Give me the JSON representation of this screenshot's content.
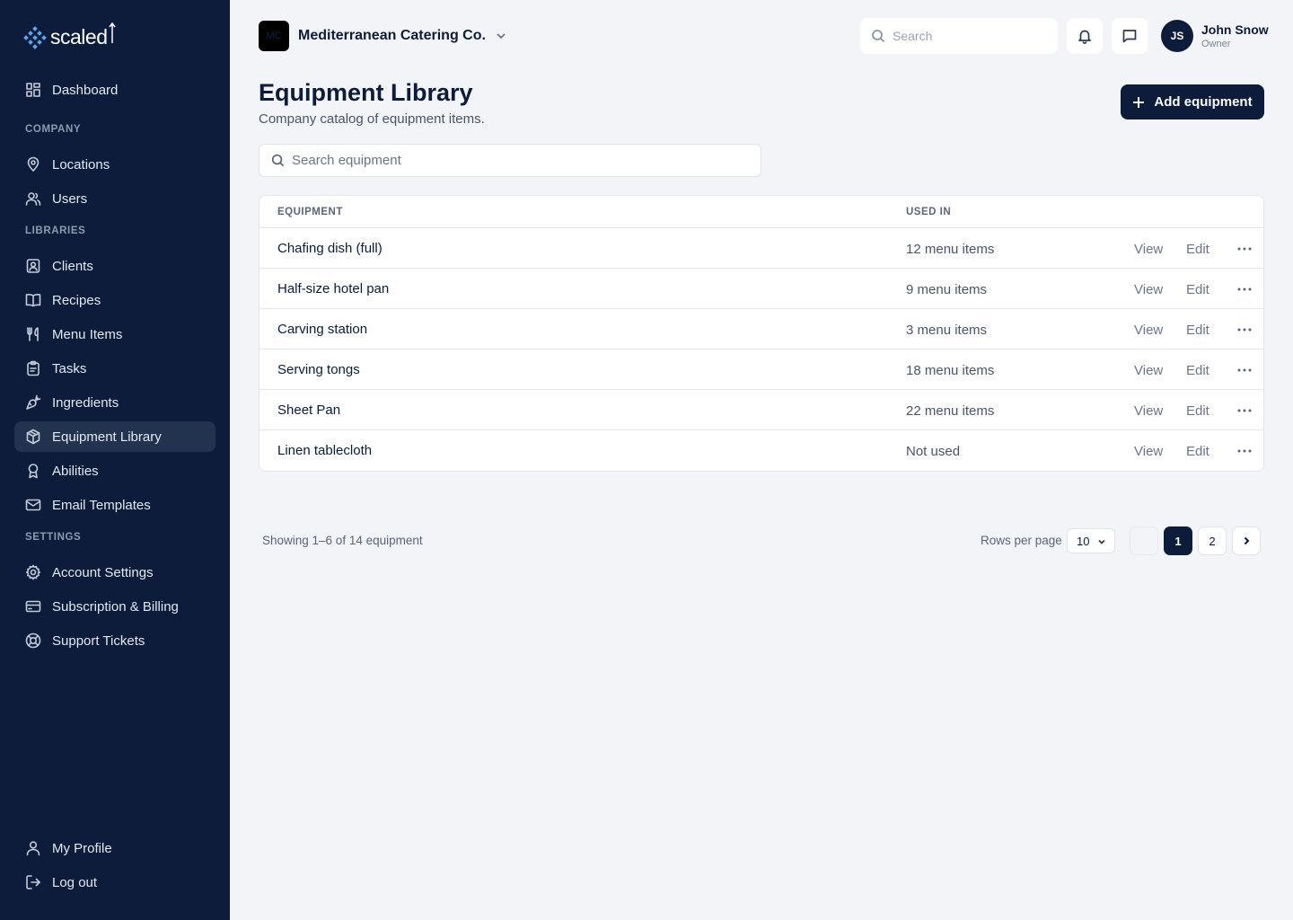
{
  "brand": {
    "logo_text": "scaled",
    "logo_icon": "diamond-grid-logo-icon",
    "accent": "#0c1c3a"
  },
  "sidebar": {
    "top_items": [
      {
        "label": "Dashboard",
        "icon": "dashboard-icon"
      }
    ],
    "sections": [
      {
        "label": "COMPANY",
        "items": [
          {
            "label": "Locations",
            "icon": "location-pin-icon"
          },
          {
            "label": "Users",
            "icon": "users-icon"
          }
        ]
      },
      {
        "label": "LIBRARIES",
        "items": [
          {
            "label": "Clients",
            "icon": "contact-card-icon"
          },
          {
            "label": "Recipes",
            "icon": "book-icon"
          },
          {
            "label": "Menu Items",
            "icon": "utensils-icon"
          },
          {
            "label": "Tasks",
            "icon": "clipboard-icon"
          },
          {
            "label": "Ingredients",
            "icon": "carrot-icon"
          },
          {
            "label": "Equipment Library",
            "icon": "package-icon",
            "active": true
          },
          {
            "label": "Abilities",
            "icon": "award-icon"
          },
          {
            "label": "Email Templates",
            "icon": "mail-icon"
          }
        ]
      },
      {
        "label": "SETTINGS",
        "items": [
          {
            "label": "Account Settings",
            "icon": "gear-icon"
          },
          {
            "label": "Subscription & Billing",
            "icon": "credit-card-icon"
          },
          {
            "label": "Support Tickets",
            "icon": "lifebuoy-icon"
          }
        ]
      }
    ],
    "bottom_items": [
      {
        "label": "My Profile",
        "icon": "user-icon"
      },
      {
        "label": "Log out",
        "icon": "logout-icon"
      }
    ]
  },
  "topbar": {
    "company_initials": "MC",
    "company_name": "Mediterranean Catering Co.",
    "search_placeholder": "Search",
    "user_initials": "JS",
    "user_name": "John Snow",
    "user_role": "Owner"
  },
  "header": {
    "title": "Equipment Library",
    "subtitle": "Company catalog of equipment items.",
    "add_button": "Add equipment",
    "search_placeholder": "Search equipment"
  },
  "table": {
    "columns": [
      "EQUIPMENT",
      "USED IN"
    ],
    "view_label": "View",
    "edit_label": "Edit",
    "rows": [
      {
        "name": "Chafing dish (full)",
        "used_in": "12 menu items"
      },
      {
        "name": "Half-size hotel pan",
        "used_in": "9 menu items"
      },
      {
        "name": "Carving station",
        "used_in": "3 menu items"
      },
      {
        "name": "Serving tongs",
        "used_in": "18 menu items"
      },
      {
        "name": "Sheet Pan",
        "used_in": "22 menu items"
      },
      {
        "name": "Linen tablecloth",
        "used_in": "Not used"
      }
    ]
  },
  "pagination": {
    "showing": "Showing 1–6 of 14 equipment",
    "rows_per_page_label": "Rows per page",
    "rows_per_page_value": "10",
    "pages": [
      "1",
      "2"
    ],
    "current_page": "1"
  }
}
